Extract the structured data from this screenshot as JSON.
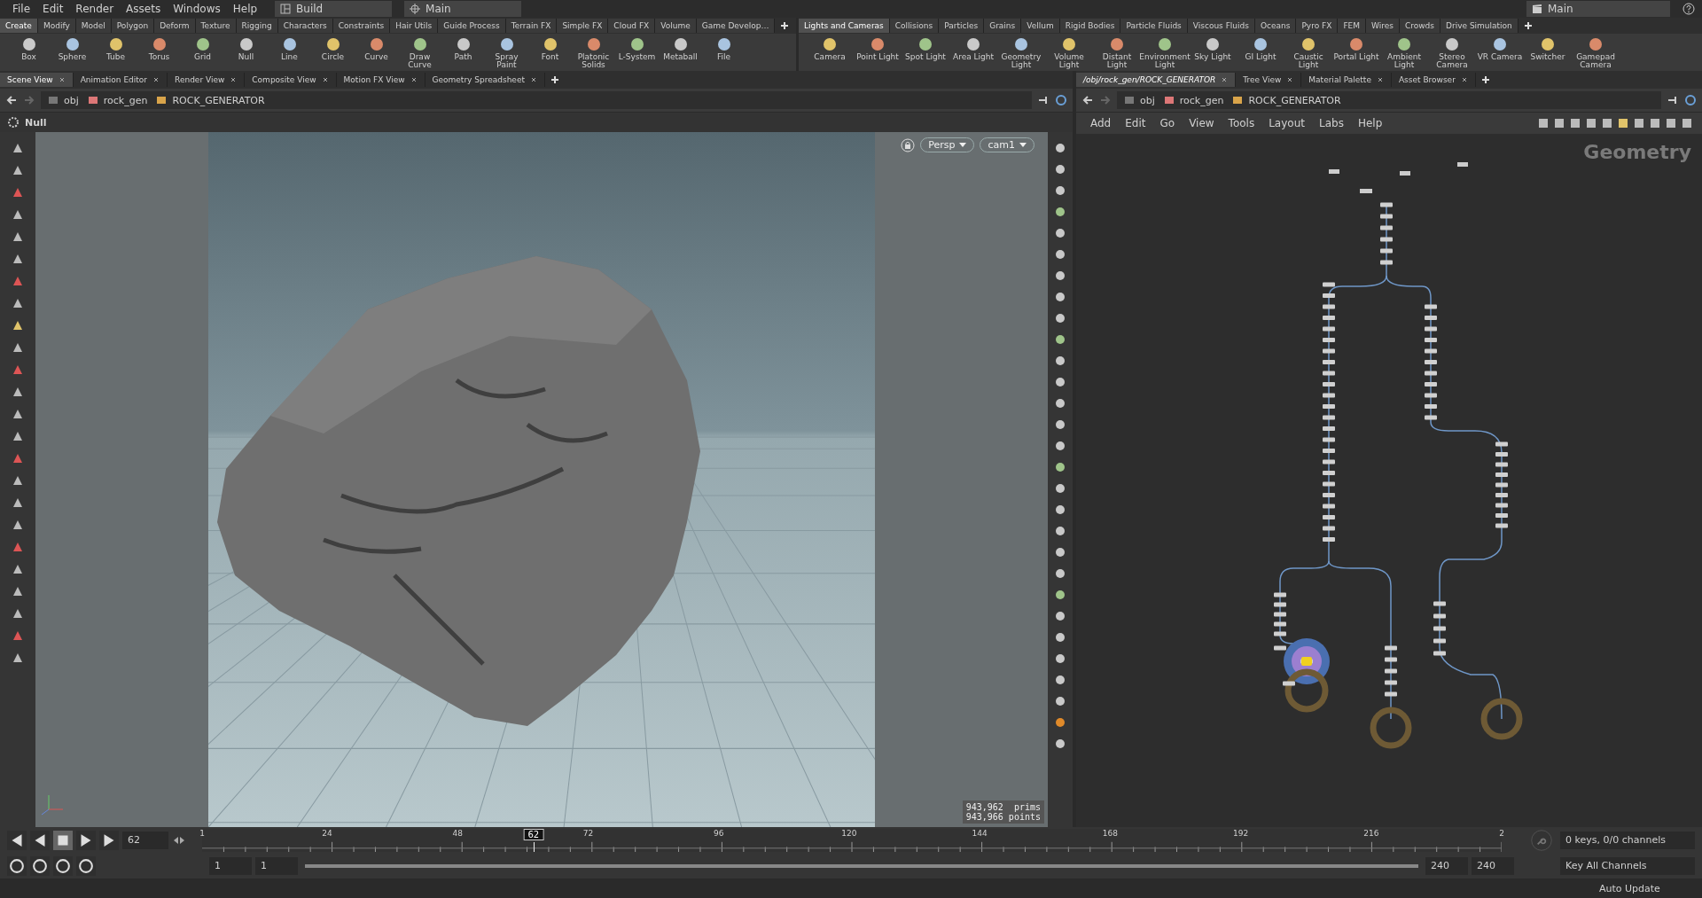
{
  "menu": [
    "File",
    "Edit",
    "Render",
    "Assets",
    "Windows",
    "Help"
  ],
  "desktop": "Build",
  "viewport_layout": "Main",
  "right_desktop": "Main",
  "shelf_left": {
    "tabs": [
      {
        "label": "Create",
        "selected": true
      },
      {
        "label": "Modify",
        "selected": false
      },
      {
        "label": "Model",
        "selected": false
      },
      {
        "label": "Polygon",
        "selected": false
      },
      {
        "label": "Deform",
        "selected": false
      },
      {
        "label": "Texture",
        "selected": false
      },
      {
        "label": "Rigging",
        "selected": false
      },
      {
        "label": "Characters",
        "selected": false
      },
      {
        "label": "Constraints",
        "selected": false
      },
      {
        "label": "Hair Utils",
        "selected": false
      },
      {
        "label": "Guide Process",
        "selected": false
      },
      {
        "label": "Terrain FX",
        "selected": false
      },
      {
        "label": "Simple FX",
        "selected": false
      },
      {
        "label": "Cloud FX",
        "selected": false
      },
      {
        "label": "Volume",
        "selected": false
      },
      {
        "label": "Game Develop…",
        "selected": false
      }
    ],
    "tools": [
      "Box",
      "Sphere",
      "Tube",
      "Torus",
      "Grid",
      "Null",
      "Line",
      "Circle",
      "Curve",
      "Draw Curve",
      "Path",
      "Spray Paint",
      "Font",
      "Platonic Solids",
      "L-System",
      "Metaball",
      "File"
    ]
  },
  "shelf_right": {
    "tabs": [
      {
        "label": "Lights and Cameras",
        "selected": true
      },
      {
        "label": "Collisions",
        "selected": false
      },
      {
        "label": "Particles",
        "selected": false
      },
      {
        "label": "Grains",
        "selected": false
      },
      {
        "label": "Vellum",
        "selected": false
      },
      {
        "label": "Rigid Bodies",
        "selected": false
      },
      {
        "label": "Particle Fluids",
        "selected": false
      },
      {
        "label": "Viscous Fluids",
        "selected": false
      },
      {
        "label": "Oceans",
        "selected": false
      },
      {
        "label": "Pyro FX",
        "selected": false
      },
      {
        "label": "FEM",
        "selected": false
      },
      {
        "label": "Wires",
        "selected": false
      },
      {
        "label": "Crowds",
        "selected": false
      },
      {
        "label": "Drive Simulation",
        "selected": false
      }
    ],
    "tools": [
      "Camera",
      "Point Light",
      "Spot Light",
      "Area Light",
      "Geometry Light",
      "Volume Light",
      "Distant Light",
      "Environment Light",
      "Sky Light",
      "GI Light",
      "Caustic Light",
      "Portal Light",
      "Ambient Light",
      "Stereo Camera",
      "VR Camera",
      "Switcher",
      "Gamepad Camera"
    ]
  },
  "left_pane": {
    "tabs": [
      {
        "label": "Scene View",
        "selected": true
      },
      {
        "label": "Animation Editor",
        "selected": false
      },
      {
        "label": "Render View",
        "selected": false
      },
      {
        "label": "Composite View",
        "selected": false
      },
      {
        "label": "Motion FX View",
        "selected": false
      },
      {
        "label": "Geometry Spreadsheet",
        "selected": false
      }
    ],
    "path": [
      "obj",
      "rock_gen",
      "ROCK_GENERATOR"
    ],
    "operation": "Null",
    "camera_view": "Persp",
    "camera": "cam1",
    "stats": [
      "943,962  prims",
      "943,966 points"
    ]
  },
  "right_pane": {
    "tabs": [
      {
        "label": "/obj/rock_gen/ROCK_GENERATOR",
        "selected": true
      },
      {
        "label": "Tree View",
        "selected": false
      },
      {
        "label": "Material Palette",
        "selected": false
      },
      {
        "label": "Asset Browser",
        "selected": false
      }
    ],
    "path": [
      "obj",
      "rock_gen",
      "ROCK_GENERATOR"
    ],
    "menu": [
      "Add",
      "Edit",
      "Go",
      "View",
      "Tools",
      "Layout",
      "Labs",
      "Help"
    ],
    "context_label": "Geometry"
  },
  "timeline": {
    "current_frame": "62",
    "playhead": {
      "label": "62",
      "level": 0.255
    },
    "range": {
      "level": 1
    },
    "ruler": [
      "1",
      "24",
      "48",
      "72",
      "96",
      "120",
      "144",
      "168",
      "192",
      "216",
      "2"
    ],
    "range_start": "1",
    "start": "1",
    "end": "240",
    "range_end": "240",
    "keys": "0 keys, 0/0 channels",
    "key_mode": "Key All Channels"
  },
  "status": {
    "update_mode": "Auto Update"
  }
}
